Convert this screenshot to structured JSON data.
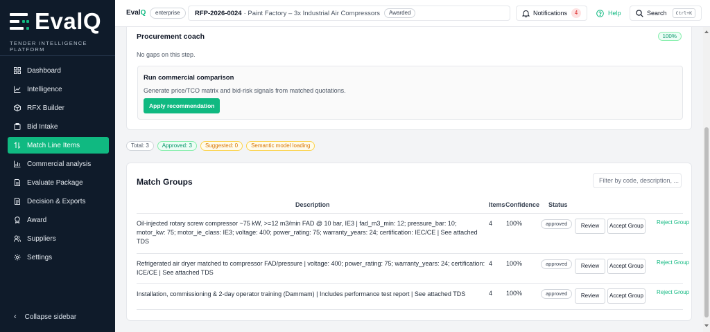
{
  "sidebar": {
    "logo": "EvalQ",
    "tagline": "TENDER INTELLIGENCE PLATFORM",
    "items": [
      {
        "label": "Dashboard",
        "icon": "grid-icon"
      },
      {
        "label": "Intelligence",
        "icon": "trend-chart-icon"
      },
      {
        "label": "RFX Builder",
        "icon": "cube-icon"
      },
      {
        "label": "Bid Intake",
        "icon": "clipboard-icon"
      },
      {
        "label": "Match Line Items",
        "icon": "swap-arrows-icon",
        "active": true
      },
      {
        "label": "Commercial analysis",
        "icon": "bar-chart-icon"
      },
      {
        "label": "Evaluate Package",
        "icon": "document-icon"
      },
      {
        "label": "Decision & Exports",
        "icon": "file-export-icon"
      },
      {
        "label": "Award",
        "icon": "award-icon"
      },
      {
        "label": "Suppliers",
        "icon": "users-icon"
      },
      {
        "label": "Settings",
        "icon": "gear-icon"
      }
    ],
    "collapse_label": "Collapse sidebar"
  },
  "header": {
    "brand_prefix": "Eval",
    "brand_suffix": "Q",
    "plan": "enterprise",
    "rfp_code": "RFP-2026-0024",
    "rfp_title": "· Paint Factory – 3x Industrial Air Compressors",
    "rfp_status": "Awarded",
    "notifications_label": "Notifications",
    "notifications_count": "4",
    "help_label": "Help",
    "search_label": "Search",
    "search_shortcut": "Ctrl+K"
  },
  "coach": {
    "title": "Procurement coach",
    "progress": "100%",
    "note": "No gaps on this step.",
    "recommendation": {
      "title": "Run commercial comparison",
      "description": "Generate price/TCO matrix and bid-risk signals from matched quotations.",
      "button": "Apply recommendation"
    }
  },
  "summary": {
    "total": "Total: 3",
    "approved": "Approved: 3",
    "suggested": "Suggested: 0",
    "semantic": "Semantic model loading"
  },
  "groups": {
    "title": "Match Groups",
    "filter_placeholder": "Filter by code, description, ...",
    "columns": {
      "description": "Description",
      "items": "Items",
      "confidence": "Confidence",
      "status": "Status"
    },
    "rows": [
      {
        "description": "Oil-injected rotary screw compressor ~75 kW, >=12 m3/min FAD @ 10 bar, IE3 | fad_m3_min: 12; pressure_bar: 10; motor_kw: 75; motor_ie_class: IE3; voltage: 400; power_rating: 75; warranty_years: 24; certification: IEC/CE | See attached TDS",
        "items": "4",
        "confidence": "100%",
        "status": "approved",
        "review": "Review",
        "accept": "Accept Group",
        "reject": "Reject Group"
      },
      {
        "description": "Refrigerated air dryer matched to compressor FAD/pressure | voltage: 400; power_rating: 75; warranty_years: 24; certification: ICE/CE | See attached TDS",
        "items": "4",
        "confidence": "100%",
        "status": "approved",
        "review": "Review",
        "accept": "Accept Group",
        "reject": "Reject Group"
      },
      {
        "description": "Installation, commissioning & 2-day operator training (Dammam) | Includes performance test report | See attached TDS",
        "items": "4",
        "confidence": "100%",
        "status": "approved",
        "review": "Review",
        "accept": "Accept Group",
        "reject": "Reject Group"
      }
    ]
  },
  "colors": {
    "accent": "#10b981",
    "sidebar_bg": "#0f1b2a",
    "warning": "#d97706",
    "danger": "#dc2626"
  }
}
